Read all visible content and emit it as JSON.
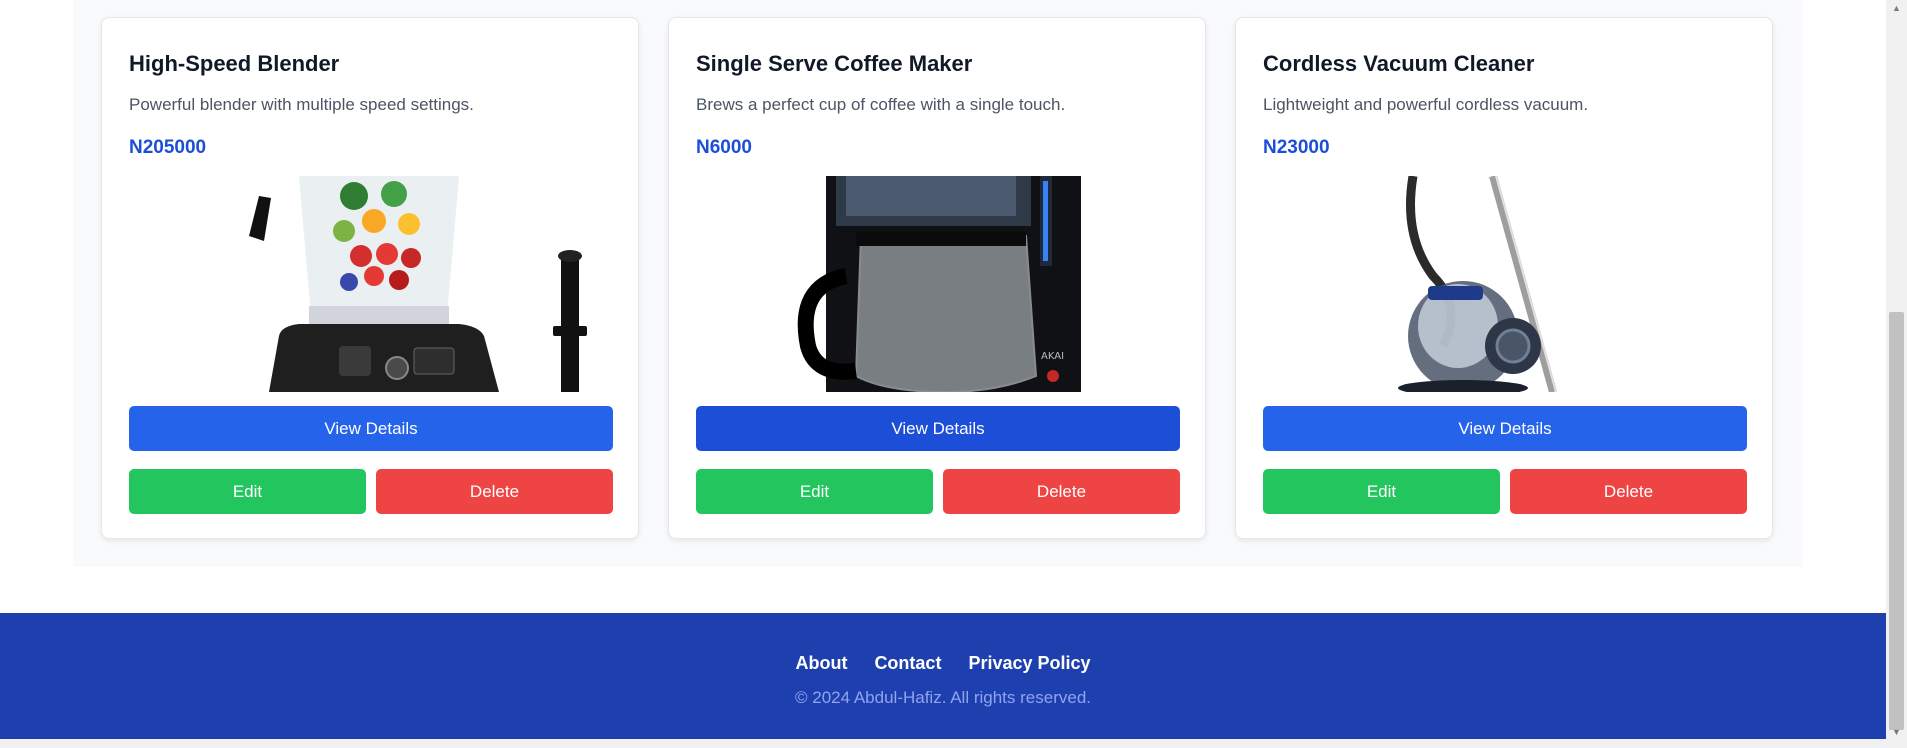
{
  "products": [
    {
      "title": "High-Speed Blender",
      "description": "Powerful blender with multiple speed settings.",
      "price": "N205000",
      "image_icon": "blender-image",
      "view_label": "View Details",
      "edit_label": "Edit",
      "delete_label": "Delete"
    },
    {
      "title": "Single Serve Coffee Maker",
      "description": "Brews a perfect cup of coffee with a single touch.",
      "price": "N6000",
      "image_icon": "coffee-maker-image",
      "view_label": "View Details",
      "edit_label": "Edit",
      "delete_label": "Delete"
    },
    {
      "title": "Cordless Vacuum Cleaner",
      "description": "Lightweight and powerful cordless vacuum.",
      "price": "N23000",
      "image_icon": "vacuum-cleaner-image",
      "view_label": "View Details",
      "edit_label": "Edit",
      "delete_label": "Delete"
    }
  ],
  "footer": {
    "links": [
      "About",
      "Contact",
      "Privacy Policy"
    ],
    "copyright": "© 2024 Abdul-Hafiz. All rights reserved."
  },
  "colors": {
    "primary": "#2563eb",
    "primary_active": "#1d4ed8",
    "success": "#22c55e",
    "danger": "#ef4444",
    "footer_bg": "#1e40af"
  }
}
